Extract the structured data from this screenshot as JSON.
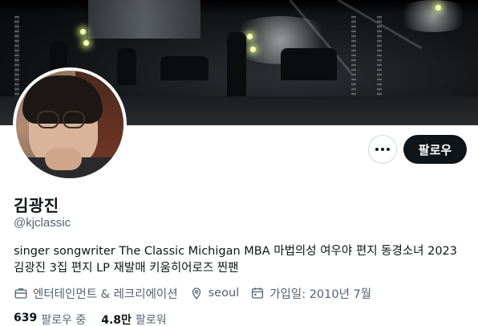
{
  "header": {
    "banner_icon": "concert-stage-photo",
    "avatar_icon": "profile-photo"
  },
  "actions": {
    "more_icon": "more-horizontal-icon",
    "follow_label": "팔로우"
  },
  "profile": {
    "display_name": "김광진",
    "handle": "@kjclassic",
    "bio_lines": [
      "singer songwriter The Classic Michigan MBA 마법의성 여우야 편지 동경소녀 2023",
      "김광진 3집 편지 LP 재발매 키움히어로즈 찐팬"
    ],
    "category": "엔터테인먼트 & 레크리에이션",
    "location": "seoul",
    "joined": "가입일: 2010년 7월"
  },
  "stats": {
    "following_count": "639",
    "following_label": "팔로우 중",
    "followers_count": "4.8만",
    "followers_label": "팔로워"
  },
  "colors": {
    "text_primary": "#0f1419",
    "text_secondary": "#536471",
    "button_dark": "#0f1419",
    "border": "#cfd9de"
  }
}
